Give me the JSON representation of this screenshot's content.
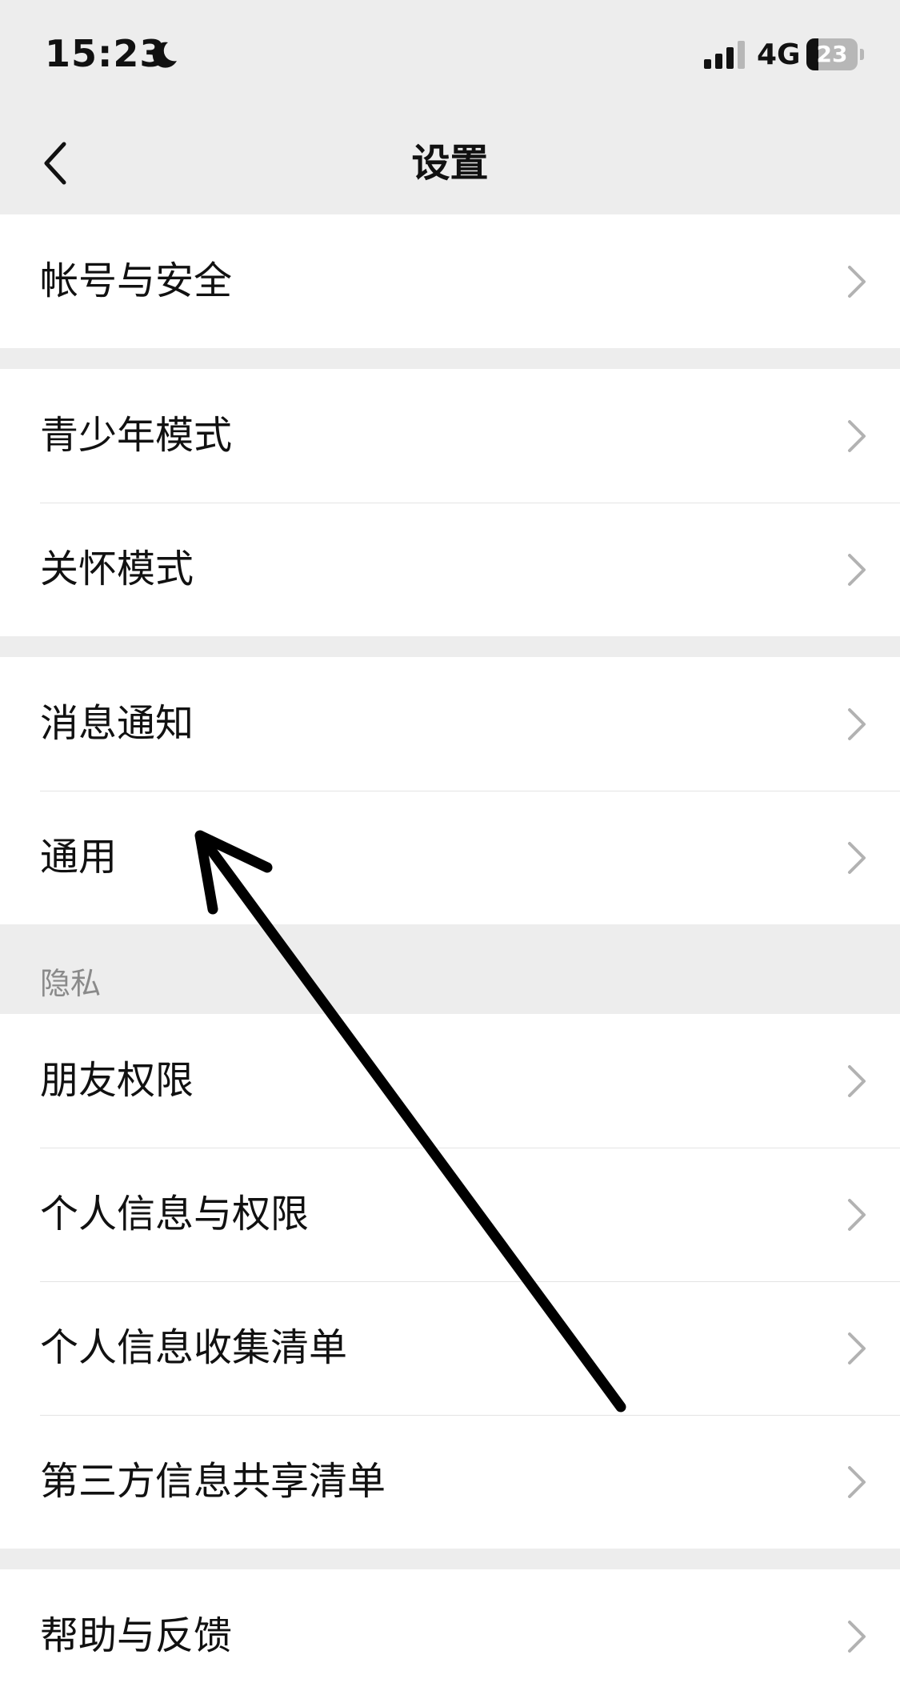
{
  "status_bar": {
    "time": "15:23",
    "network": "4G",
    "battery": "23",
    "battery_level": 0.23,
    "icons": [
      "moon-icon",
      "signal-icon",
      "battery-icon"
    ]
  },
  "nav": {
    "title": "设置",
    "back_icon": "chevron-left-icon"
  },
  "groups": {
    "account": [
      {
        "label": "帐号与安全"
      }
    ],
    "modes": [
      {
        "label": "青少年模式"
      },
      {
        "label": "关怀模式"
      }
    ],
    "general": [
      {
        "label": "消息通知"
      },
      {
        "label": "通用"
      }
    ],
    "privacy_header": "隐私",
    "privacy": [
      {
        "label": "朋友权限"
      },
      {
        "label": "个人信息与权限"
      },
      {
        "label": "个人信息收集清单"
      },
      {
        "label": "第三方信息共享清单"
      }
    ],
    "support": [
      {
        "label": "帮助与反馈"
      }
    ]
  },
  "colors": {
    "background": "#ededed",
    "card": "#ffffff",
    "text": "#111111",
    "secondary_text": "#8a8a8a",
    "chevron": "#b2b2b2",
    "annotation_arrow": "#000000"
  },
  "annotation": {
    "icon": "arrow-annotation-icon"
  }
}
